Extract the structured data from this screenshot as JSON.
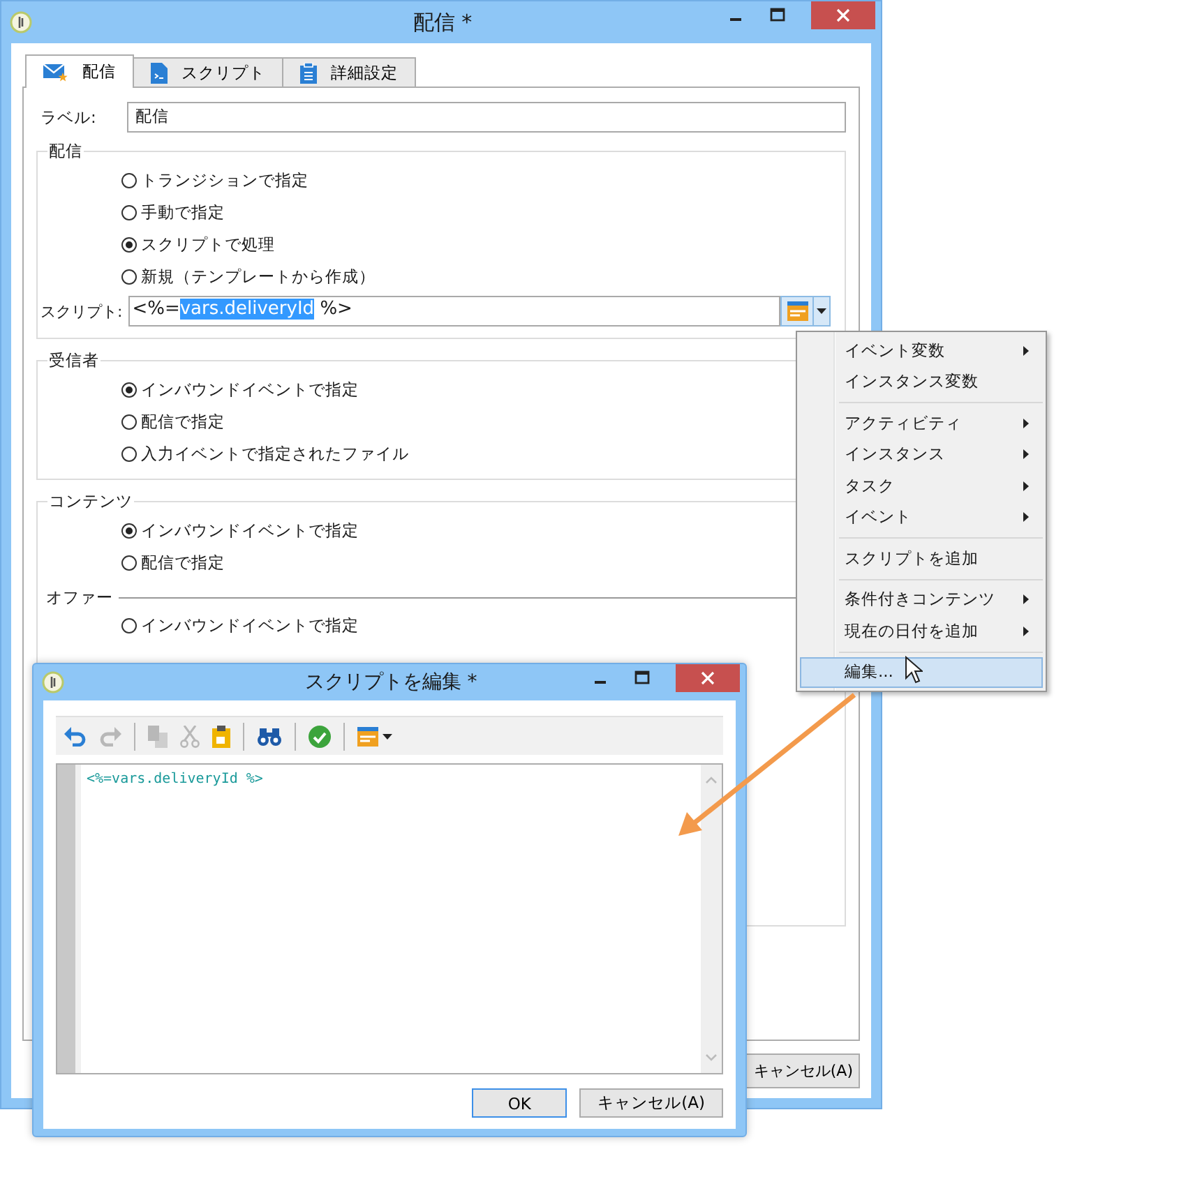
{
  "main_window": {
    "title": "配信 *",
    "tabs": [
      {
        "label": "配信",
        "selected": true
      },
      {
        "label": "スクリプト",
        "selected": false
      },
      {
        "label": "詳細設定",
        "selected": false
      }
    ],
    "label_field": {
      "label": "ラベル:",
      "value": "配信"
    },
    "groups": [
      {
        "title": "配信",
        "options": [
          {
            "label": "トランジションで指定",
            "selected": false
          },
          {
            "label": "手動で指定",
            "selected": false
          },
          {
            "label": "スクリプトで処理",
            "selected": true
          },
          {
            "label": "新規（テンプレートから作成）",
            "selected": false
          }
        ],
        "script": {
          "label": "スクリプト:",
          "before": "<%=",
          "highlighted": "vars.deliveryId",
          "after": " %>"
        }
      },
      {
        "title": "受信者",
        "options": [
          {
            "label": "インバウンドイベントで指定",
            "selected": true
          },
          {
            "label": "配信で指定",
            "selected": false
          },
          {
            "label": "入力イベントで指定されたファイル",
            "selected": false
          }
        ]
      },
      {
        "title": "コンテンツ",
        "options": [
          {
            "label": "インバウンドイベントで指定",
            "selected": true
          },
          {
            "label": "配信で指定",
            "selected": false
          }
        ],
        "subgroup": {
          "title": "オファー",
          "options": [
            {
              "label": "インバウンドイベントで指定",
              "selected": false
            }
          ]
        }
      }
    ],
    "cancel_button": "キャンセル(A)"
  },
  "menu": {
    "sections": [
      [
        {
          "label": "イベント変数",
          "submenu": true,
          "selected": false
        },
        {
          "label": "インスタンス変数",
          "submenu": false,
          "selected": false
        }
      ],
      [
        {
          "label": "アクティビティ",
          "submenu": true,
          "selected": false
        },
        {
          "label": "インスタンス",
          "submenu": true,
          "selected": false
        },
        {
          "label": "タスク",
          "submenu": true,
          "selected": false
        },
        {
          "label": "イベント",
          "submenu": true,
          "selected": false
        }
      ],
      [
        {
          "label": "スクリプトを追加",
          "submenu": false,
          "selected": false
        }
      ],
      [
        {
          "label": "条件付きコンテンツ",
          "submenu": true,
          "selected": false
        },
        {
          "label": "現在の日付を追加",
          "submenu": true,
          "selected": false
        }
      ],
      [
        {
          "label": "編集...",
          "submenu": false,
          "selected": true
        }
      ]
    ]
  },
  "dialog": {
    "title": "スクリプトを編集 *",
    "toolbar": [
      {
        "kind": "undo",
        "disabled": false
      },
      {
        "kind": "redo",
        "disabled": true
      },
      {
        "kind": "separator"
      },
      {
        "kind": "copy",
        "disabled": true
      },
      {
        "kind": "cut",
        "disabled": true
      },
      {
        "kind": "paste",
        "disabled": false
      },
      {
        "kind": "separator"
      },
      {
        "kind": "find",
        "disabled": false
      },
      {
        "kind": "separator"
      },
      {
        "kind": "check",
        "disabled": false
      },
      {
        "kind": "separator"
      },
      {
        "kind": "insert",
        "disabled": false
      }
    ],
    "code": "<%=vars.deliveryId %>",
    "buttons": [
      {
        "label": "OK",
        "default": true
      },
      {
        "label": "キャンセル(A)",
        "default": false
      }
    ]
  }
}
